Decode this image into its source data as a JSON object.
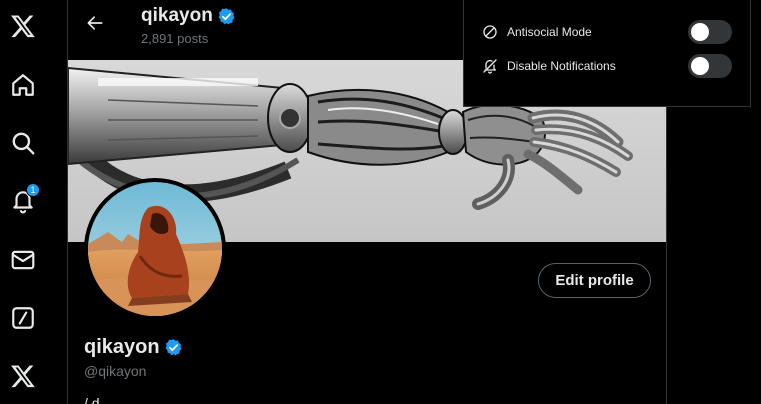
{
  "nav": {
    "items": [
      "x-logo",
      "home",
      "explore",
      "notifications",
      "messages",
      "grok",
      "premium"
    ],
    "notifications_badge": "1"
  },
  "header": {
    "name": "qikayon",
    "posts": "2,891 posts"
  },
  "profile": {
    "name": "qikayon",
    "handle": "@qikayon",
    "bio_fragment": "/ d  ... ... ... ... ... ...",
    "edit_label": "Edit profile"
  },
  "settings_popup": {
    "options": [
      {
        "label": "Antisocial Mode",
        "icon": "prohibited-icon",
        "enabled": false
      },
      {
        "label": "Disable Notifications",
        "icon": "bell-off-icon",
        "enabled": false
      }
    ]
  },
  "colors": {
    "accent": "#1d9bf0",
    "background": "#000000",
    "border": "#2f3336",
    "muted": "#71767b"
  }
}
